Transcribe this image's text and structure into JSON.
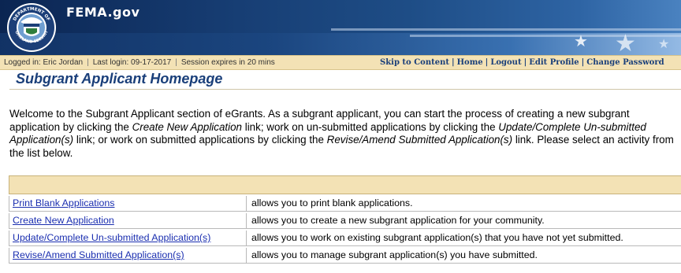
{
  "header": {
    "site_title": "FEMA.gov",
    "seal_text": [
      "DEPARTMENT OF",
      "HOMELAND SECURITY"
    ]
  },
  "status_bar": {
    "logged_in": "Logged in: Eric Jordan",
    "last_login": "Last login: 09-17-2017",
    "session": "Session expires in 20 mins",
    "links": [
      "Skip to Content",
      "Home",
      "Logout",
      "Edit Profile",
      "Change Password"
    ]
  },
  "page": {
    "title": "Subgrant Applicant Homepage",
    "intro": {
      "p1": "Welcome to the Subgrant Applicant section of eGrants. As a subgrant applicant, you can start the process of creating a new subgrant application by clicking the ",
      "em1": "Create New Application",
      "p2": " link; work on un-submitted applications by clicking the ",
      "em2": "Update/Complete Un-submitted Application(s)",
      "p3": " link; or work on submitted applications by clicking the ",
      "em3": "Revise/Amend Submitted Application(s)",
      "p4": " link. Please select an activity from the list below."
    }
  },
  "activities": [
    {
      "link": "Print Blank Applications",
      "description": "allows you to print blank applications."
    },
    {
      "link": "Create New Application",
      "description": "allows you to create a new subgrant application for your community."
    },
    {
      "link": "Update/Complete Un-submitted Application(s)",
      "description": "allows you to work on existing subgrant application(s) that you have not yet submitted."
    },
    {
      "link": "Revise/Amend Submitted Application(s)",
      "description": "allows you to manage subgrant application(s) you have submitted."
    }
  ],
  "colors": {
    "banner": "#173e74",
    "status_bar_bg": "#f3e2b5",
    "link": "#1b2fb0",
    "title": "#1a3f7a"
  }
}
